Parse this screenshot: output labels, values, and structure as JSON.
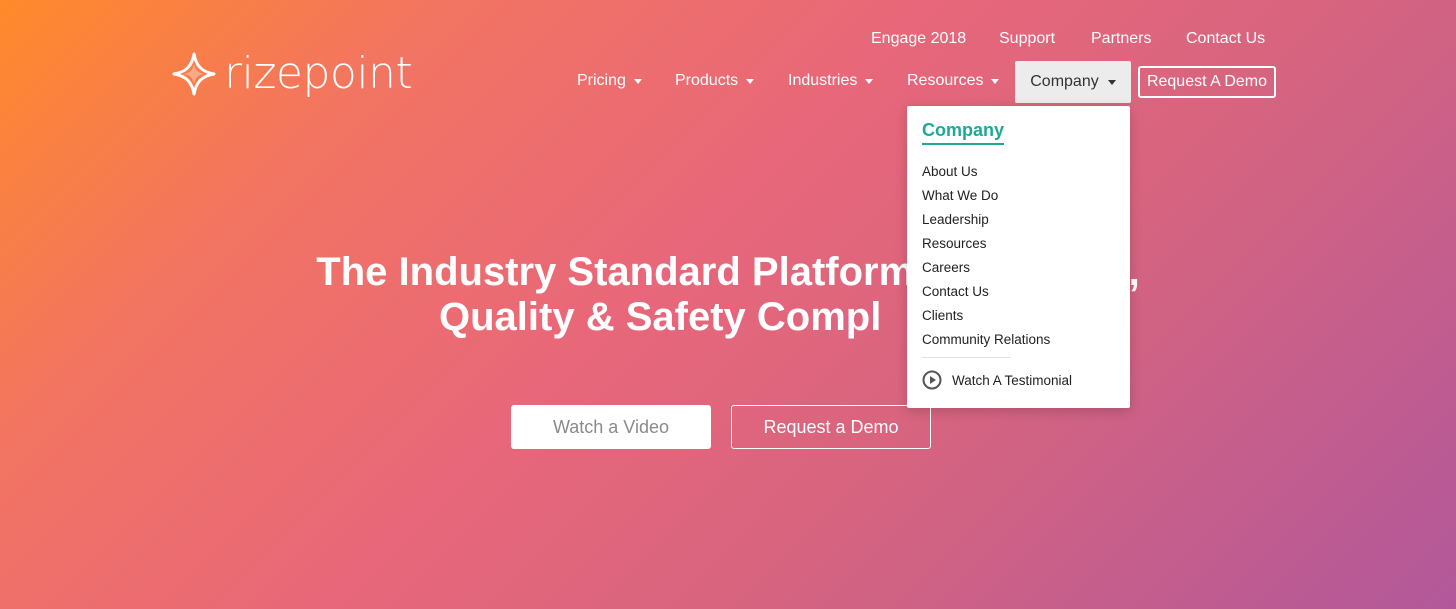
{
  "brand": {
    "name": "rizepoint",
    "icon": "sparkle-logo-icon"
  },
  "topnav": [
    {
      "label": "Engage 2018"
    },
    {
      "label": "Support"
    },
    {
      "label": "Partners"
    },
    {
      "label": "Contact Us"
    }
  ],
  "mainnav": {
    "items": [
      {
        "label": "Pricing"
      },
      {
        "label": "Products"
      },
      {
        "label": "Industries"
      },
      {
        "label": "Resources"
      }
    ],
    "company": {
      "label": "Company"
    },
    "demo": {
      "label": "Request A Demo"
    }
  },
  "dropdown": {
    "title": "Company",
    "items": [
      "About Us",
      "What We Do",
      "Leadership",
      "Resources",
      "Careers",
      "Contact Us",
      "Clients",
      "Community Relations"
    ],
    "testimonial": {
      "label": "Watch A Testimonial",
      "icon": "play-circle-icon"
    }
  },
  "hero": {
    "headline_line1_left": "The Industry Standard Platform",
    "headline_line1_right": "d,",
    "headline_line2_left": "Quality & Safety Compl",
    "watch_video": "Watch a Video",
    "request_demo": "Request a Demo"
  },
  "colors": {
    "accent": "#1fa896",
    "gradient_start": "#ff8a2b",
    "gradient_mid": "#e8677a",
    "gradient_end": "#b2589a"
  }
}
